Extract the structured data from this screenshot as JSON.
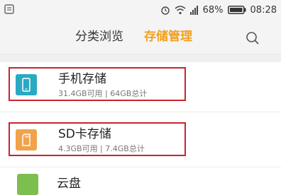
{
  "status_bar": {
    "battery_percent": "68%",
    "time": "08:28",
    "icons": [
      "notification-icon",
      "alarm-icon",
      "wifi-icon",
      "signal-icon",
      "battery-icon"
    ]
  },
  "tabs": {
    "browse": "分类浏览",
    "storage": "存储管理",
    "active": "storage"
  },
  "colors": {
    "accent": "#f5a01e",
    "highlight_border": "#c8232c",
    "phone_icon": "#2aa9c2",
    "sd_icon": "#f1a24a"
  },
  "storage_items": [
    {
      "title": "手机存储",
      "subtitle": "31.4GB可用 | 64GB总计",
      "icon": "phone-storage-icon"
    },
    {
      "title": "SD卡存储",
      "subtitle": "4.3GB可用 | 7.4GB总计",
      "icon": "sd-card-icon"
    }
  ],
  "partial_item": {
    "title": "云盘"
  }
}
